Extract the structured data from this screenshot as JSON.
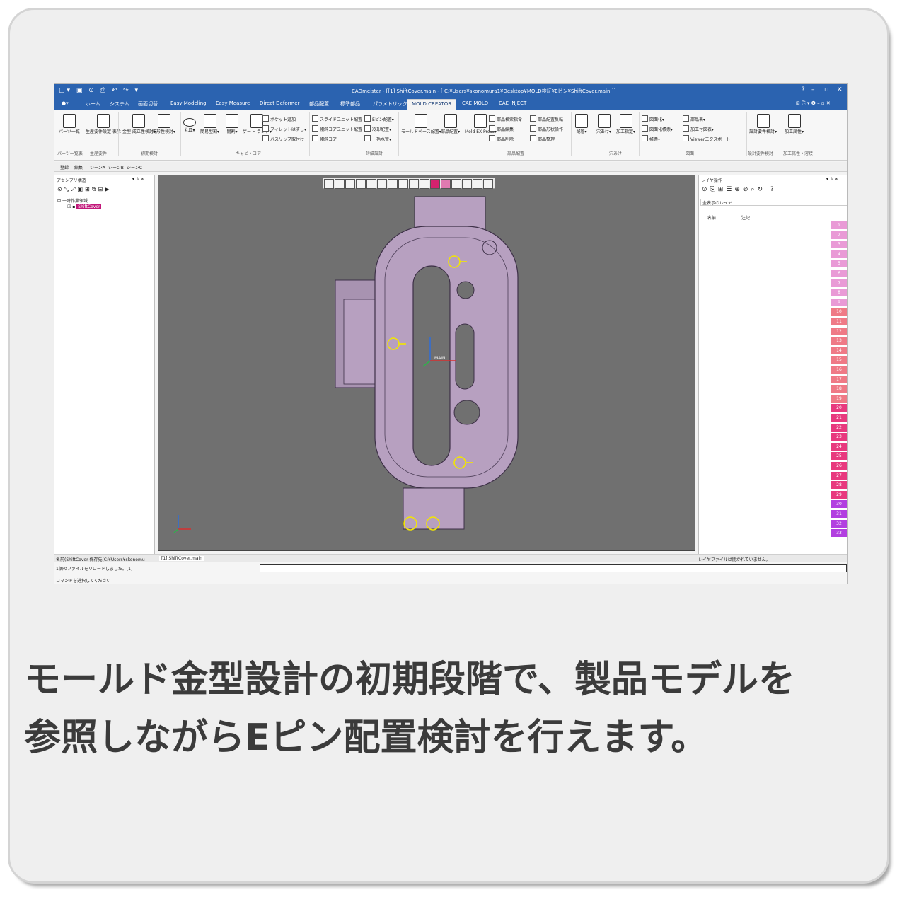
{
  "app": {
    "window_title": "CADmeister - [[1] ShiftCover.main - [ C:¥Users¥skonomura1¥Desktop¥MOLD検証¥Eピン¥ShiftCover.main ]]",
    "tabs": [
      "ホーム",
      "システム",
      "画面切替",
      "Easy Modeling",
      "Easy Measure",
      "Direct Deformer",
      "部品配置",
      "標準部品",
      "パラメトリック",
      "MOLD CREATOR",
      "CAE MOLD",
      "CAE INJECT"
    ],
    "active_tab": "MOLD CREATOR",
    "ribbon": {
      "big_buttons": [
        "パーツ一覧",
        "生産要件設定\n表示",
        "金型\n成立性検討▾",
        "成形性検討▾",
        "丸皿▾",
        "簡易型割▾",
        "開割▾",
        "ゲート\nランナ▾",
        "モールドベース配置▾",
        "部品配置▾",
        "Mold\nEX-Press▾",
        "配管▾",
        "穴あけ▾",
        "加工指定▾",
        "設計要件検討▾",
        "加工属性▾"
      ],
      "small_buttons": [
        "ボケット追加",
        "フィレットはずし▾",
        "パスリップ取付け",
        "スライドユニット配置",
        "傾斜コアユニット配置",
        "傾斜コア",
        "Eピン配置▾",
        "冷却配置▾",
        "一括水管▾",
        "部品検索指令",
        "部品編集",
        "部品削除",
        "部品配置反転",
        "部品形状操作",
        "部品整理",
        "図面化▾",
        "図面化帳票▾",
        "帳票▾",
        "部品表▾",
        "加工付図表▾",
        "Viewerエクスポート"
      ],
      "groups": [
        "パーツ一覧表",
        "生産要件",
        "初期検討",
        "キャビ・コア",
        "詳細設計",
        "部品配置",
        "穴あけ",
        "図面",
        "設計要件検討",
        "加工属性・溶接"
      ]
    },
    "subbar": [
      "登録",
      "編集",
      "シーンA",
      "シーンB",
      "シーンC"
    ],
    "left_panel": {
      "title": "アセンブリ構造",
      "tree_root": "一時作業領域",
      "tree_item": "ShiftCover"
    },
    "viewport": {
      "axis_label": "MAIN",
      "tab": "[1] ShiftCover.main"
    },
    "right_panel": {
      "title": "レイヤ操作",
      "filter": "全表示のレイヤ",
      "columns": [
        "名前",
        "注記"
      ],
      "status": "レイヤファイルは開かれていません。",
      "layers": [
        "1",
        "2",
        "3",
        "4",
        "5",
        "6",
        "7",
        "8",
        "9",
        "10",
        "11",
        "12",
        "13",
        "14",
        "15",
        "16",
        "17",
        "18",
        "19",
        "20",
        "21",
        "22",
        "23",
        "24",
        "25",
        "26",
        "27",
        "28",
        "29",
        "30",
        "31",
        "32",
        "33"
      ]
    },
    "status": {
      "tab_left": "名前(ShiftCover  保存先(C:¥Users¥skonomu",
      "message": "1個のファイルをリロードしました。[1]",
      "prompt": "コマンドを選択してください"
    }
  },
  "caption": {
    "line1": "モールド金型設計の初期段階で、製品モデルを",
    "line2": "参照しながらEピン配置検討を行えます。"
  },
  "colors": {
    "title_bar": "#2b63b0",
    "model_fill": "#b7a0c0",
    "pin_marker": "#f2e600",
    "highlight_item": "#c2187a"
  }
}
